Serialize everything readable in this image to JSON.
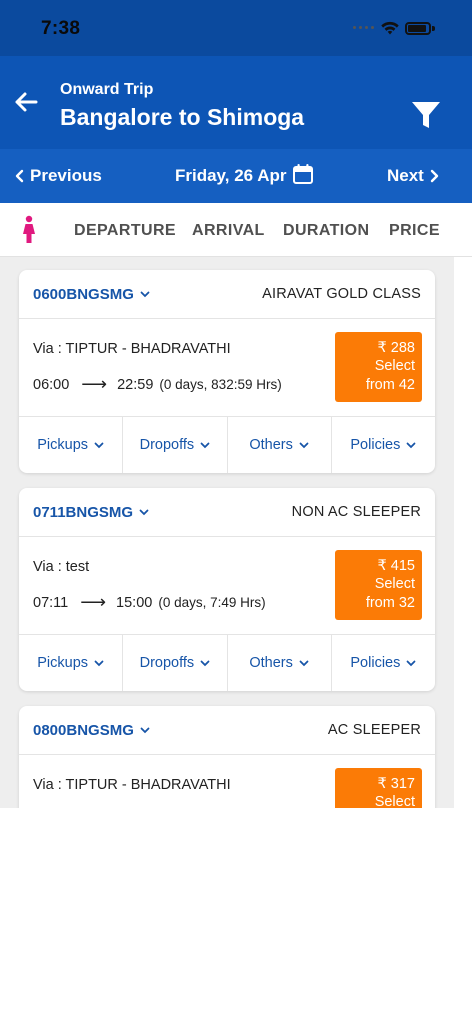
{
  "status": {
    "time": "7:38"
  },
  "header": {
    "subtitle": "Onward Trip",
    "title": "Bangalore to Shimoga"
  },
  "date_nav": {
    "prev_label": "Previous",
    "date": "Friday, 26 Apr",
    "next_label": "Next"
  },
  "sort": {
    "items": [
      "DEPARTURE",
      "ARRIVAL",
      "DURATION",
      "PRICE"
    ]
  },
  "buses": [
    {
      "code": "0600BNGSMG",
      "type": "AIRAVAT GOLD CLASS",
      "via": "Via : TIPTUR - BHADRAVATHI",
      "depart": "06:00",
      "arrive": "22:59",
      "duration": "(0 days, 832:59 Hrs)",
      "price": "₹ 288",
      "select": "Select",
      "from": "from 42"
    },
    {
      "code": "0711BNGSMG",
      "type": "NON AC SLEEPER",
      "via": "Via : test",
      "depart": "07:11",
      "arrive": "15:00",
      "duration": "(0 days, 7:49 Hrs)",
      "price": "₹ 415",
      "select": "Select",
      "from": "from 32"
    },
    {
      "code": "0800BNGSMG",
      "type": "AC SLEEPER",
      "via": "Via : TIPTUR - BHADRAVATHI",
      "price": "₹ 317",
      "select": "Select"
    }
  ],
  "card_actions": [
    "Pickups",
    "Dropoffs",
    "Others",
    "Policies"
  ],
  "colors": {
    "header": "#0d55b5",
    "date_nav": "#155fc1",
    "price_box": "#fb7b06",
    "link": "#1755a8",
    "lady_icon": "#e0197f"
  }
}
